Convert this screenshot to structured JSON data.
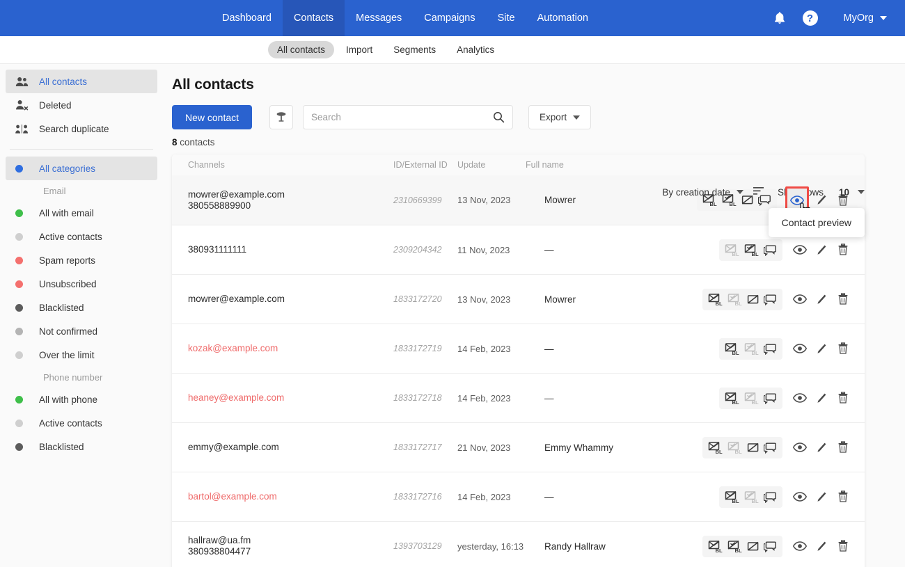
{
  "topnav": {
    "items": [
      {
        "label": "Dashboard",
        "active": false
      },
      {
        "label": "Contacts",
        "active": true
      },
      {
        "label": "Messages",
        "active": false
      },
      {
        "label": "Campaigns",
        "active": false
      },
      {
        "label": "Site",
        "active": false
      },
      {
        "label": "Automation",
        "active": false
      }
    ],
    "bell_icon": "bell-icon",
    "help_icon": "question-mark-icon",
    "org_label": "MyOrg"
  },
  "subnav": {
    "items": [
      {
        "label": "All contacts",
        "active": true
      },
      {
        "label": "Import",
        "active": false
      },
      {
        "label": "Segments",
        "active": false
      },
      {
        "label": "Analytics",
        "active": false
      }
    ]
  },
  "sidebar": {
    "primary": [
      {
        "label": "All contacts",
        "icon": "people-icon",
        "active": true
      },
      {
        "label": "Deleted",
        "icon": "person-remove-icon",
        "active": false
      },
      {
        "label": "Search duplicate",
        "icon": "compare-people-icon",
        "active": false
      }
    ],
    "all_categories": {
      "label": "All categories",
      "color": "#2f6ee0",
      "active": true
    },
    "groups": [
      {
        "title": "Email",
        "items": [
          {
            "label": "All with email",
            "color": "#3fbf4a"
          },
          {
            "label": "Active contacts",
            "color": "#cfcfcf"
          },
          {
            "label": "Spam reports",
            "color": "#f4706e"
          },
          {
            "label": "Unsubscribed",
            "color": "#f4706e"
          },
          {
            "label": "Blacklisted",
            "color": "#5c5c5c"
          },
          {
            "label": "Not confirmed",
            "color": "#b4b4b4"
          },
          {
            "label": "Over the limit",
            "color": "#cfcfcf"
          }
        ]
      },
      {
        "title": "Phone number",
        "items": [
          {
            "label": "All with phone",
            "color": "#3fbf4a"
          },
          {
            "label": "Active contacts",
            "color": "#cfcfcf"
          },
          {
            "label": "Blacklisted",
            "color": "#5c5c5c"
          }
        ]
      }
    ]
  },
  "main": {
    "page_title": "All contacts",
    "new_contact_label": "New contact",
    "filter_icon": "filter-funnel-icon",
    "search": {
      "value": "",
      "placeholder": "Search",
      "icon": "search-icon"
    },
    "export_label": "Export",
    "count_number": "8",
    "count_suffix": "contacts",
    "sort_label": "By creation date",
    "sort_direction_icon": "sort-lines-icon",
    "show_rows_label": "Show rows",
    "show_rows_value": "10",
    "tooltip": "Contact preview"
  },
  "table": {
    "headers": {
      "channels": "Channels",
      "id": "ID/External ID",
      "update": "Update",
      "fullname": "Full name"
    },
    "rows": [
      {
        "channel_email": "mowrer@example.com",
        "channel_email_red": false,
        "channel_phone": "380558889900",
        "id": "2310669399",
        "update": "13 Nov, 2023",
        "fullname": "Mowrer",
        "email_bl": "active",
        "phone_bl": "active",
        "mail_cross": "active",
        "chat": "active",
        "hovered": true,
        "eye_highlighted": true
      },
      {
        "channel_email": "",
        "channel_email_red": false,
        "channel_phone": "380931111111",
        "id": "2309204342",
        "update": "11 Nov, 2023",
        "fullname": "—",
        "email_bl": "dim",
        "phone_bl": "active",
        "mail_cross": "none",
        "chat": "active",
        "hovered": false,
        "eye_highlighted": false
      },
      {
        "channel_email": "mowrer@example.com",
        "channel_email_red": false,
        "channel_phone": "",
        "id": "1833172720",
        "update": "13 Nov, 2023",
        "fullname": "Mowrer",
        "email_bl": "active",
        "phone_bl": "dim",
        "mail_cross": "active",
        "chat": "active",
        "hovered": false,
        "eye_highlighted": false
      },
      {
        "channel_email": "kozak@example.com",
        "channel_email_red": true,
        "channel_phone": "",
        "id": "1833172719",
        "update": "14 Feb, 2023",
        "fullname": "—",
        "email_bl": "active",
        "phone_bl": "dim",
        "mail_cross": "none",
        "chat": "active",
        "hovered": false,
        "eye_highlighted": false
      },
      {
        "channel_email": "heaney@example.com",
        "channel_email_red": true,
        "channel_phone": "",
        "id": "1833172718",
        "update": "14 Feb, 2023",
        "fullname": "—",
        "email_bl": "active",
        "phone_bl": "dim",
        "mail_cross": "none",
        "chat": "active",
        "hovered": false,
        "eye_highlighted": false
      },
      {
        "channel_email": "emmy@example.com",
        "channel_email_red": false,
        "channel_phone": "",
        "id": "1833172717",
        "update": "21 Nov, 2023",
        "fullname": "Emmy Whammy",
        "email_bl": "active",
        "phone_bl": "dim",
        "mail_cross": "active",
        "chat": "active",
        "hovered": false,
        "eye_highlighted": false
      },
      {
        "channel_email": "bartol@example.com",
        "channel_email_red": true,
        "channel_phone": "",
        "id": "1833172716",
        "update": "14 Feb, 2023",
        "fullname": "—",
        "email_bl": "active",
        "phone_bl": "dim",
        "mail_cross": "none",
        "chat": "active",
        "hovered": false,
        "eye_highlighted": false
      },
      {
        "channel_email": "hallraw@ua.fm",
        "channel_email_red": false,
        "channel_phone": "380938804477",
        "id": "1393703129",
        "update": "yesterday, 16:13",
        "fullname": "Randy Hallraw",
        "email_bl": "active",
        "phone_bl": "active",
        "mail_cross": "active",
        "chat": "active",
        "hovered": false,
        "eye_highlighted": false
      }
    ],
    "action_icons": {
      "email_bl": "email-blacklist-icon",
      "phone_bl": "phone-blacklist-icon",
      "mail_cross": "mail-crossed-icon",
      "chat": "chat-bubble-icon",
      "view": "eye-icon",
      "edit": "pencil-icon",
      "delete": "trash-icon"
    }
  },
  "colors": {
    "brand_blue": "#2a62cf",
    "active_tab_blue": "#2756b8",
    "highlight_red": "#f04b45",
    "link_blue": "#3b6fd4",
    "red_email": "#ef6a6a"
  }
}
